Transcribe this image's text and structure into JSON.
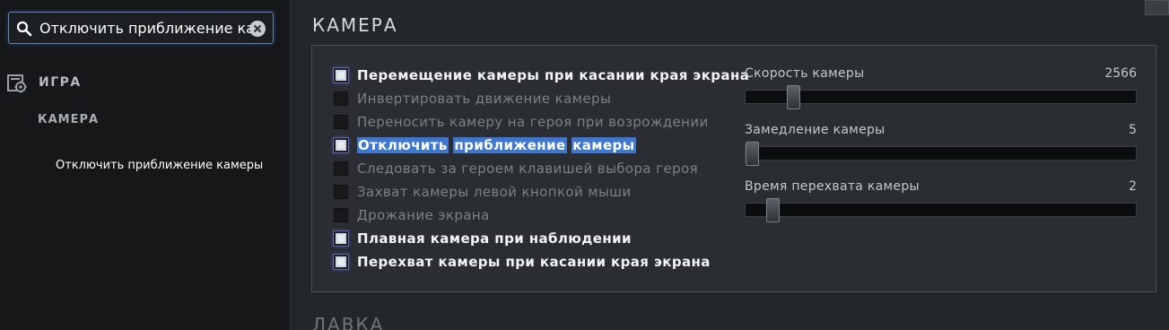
{
  "search": {
    "value": "Отключить приближение кам"
  },
  "sidebar": {
    "category_label": "ИГРА",
    "subcategory_label": "КАМЕРА",
    "result_label": "Отключить приближение камеры"
  },
  "main": {
    "section_title": "КАМЕРА",
    "next_section_title": "ЛАВКА",
    "checkboxes": [
      {
        "label": "Перемещение камеры при касании края экрана",
        "checked": true
      },
      {
        "label": "Инвертировать движение камеры",
        "checked": false
      },
      {
        "label": "Переносить камеру на героя при возрождении",
        "checked": false
      },
      {
        "label": "Отключить приближение камеры",
        "checked": true,
        "highlight_words": [
          "Отключить",
          "приближение",
          "камеры"
        ]
      },
      {
        "label": "Следовать за героем клавишей выбора героя",
        "checked": false
      },
      {
        "label": "Захват камеры левой кнопкой мыши",
        "checked": false
      },
      {
        "label": "Дрожание экрана",
        "checked": false
      },
      {
        "label": "Плавная камера при наблюдении",
        "checked": true
      },
      {
        "label": "Перехват камеры при касании края экрана",
        "checked": true
      }
    ],
    "sliders": [
      {
        "label": "Скорость камеры",
        "value": "2566",
        "fill_fraction": 0.11
      },
      {
        "label": "Замедление камеры",
        "value": "5",
        "fill_fraction": 0.0
      },
      {
        "label": "Время перехвата камеры",
        "value": "2",
        "fill_fraction": 0.055
      }
    ]
  },
  "colors": {
    "accent_highlight": "#3e77d2",
    "search_border": "#5a88c4",
    "checkbox_glow": "#5d63b8"
  },
  "icons": {
    "search": "search-icon",
    "clear": "clear-icon",
    "category": "settings-page-icon"
  }
}
